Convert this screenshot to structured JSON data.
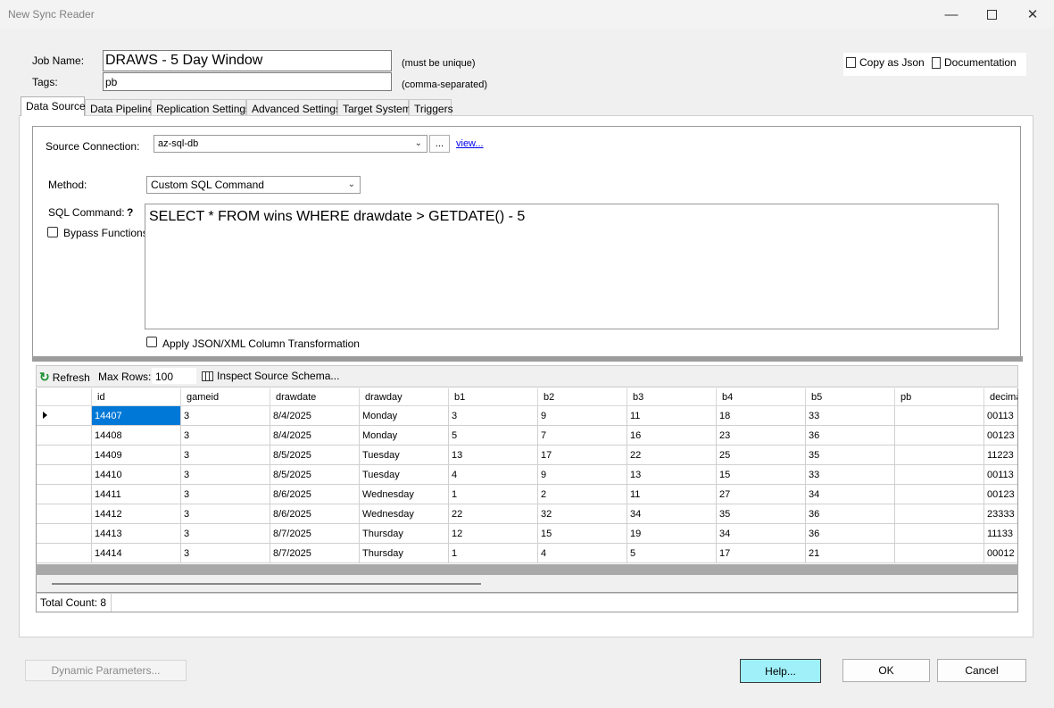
{
  "window": {
    "title": "New Sync Reader"
  },
  "header": {
    "job_name_label": "Job Name:",
    "job_name_value": "DRAWS - 5 Day Window",
    "job_name_hint": "(must be unique)",
    "tags_label": "Tags:",
    "tags_value": "pb",
    "tags_hint": "(comma-separated)",
    "copy_json_label": "Copy as Json",
    "documentation_label": "Documentation"
  },
  "tabs": [
    "Data Source",
    "Data Pipeline",
    "Replication Settings",
    "Advanced Settings",
    "Target System",
    "Triggers"
  ],
  "source": {
    "connection_label": "Source Connection:",
    "connection_value": "az-sql-db",
    "browse_label": "...",
    "view_link": "view...",
    "method_label": "Method:",
    "method_value": "Custom SQL Command",
    "sql_label": "SQL Command:",
    "help_mark": "?",
    "bypass_label": "Bypass Functions",
    "sql_value": "SELECT * FROM wins WHERE drawdate > GETDATE() - 5",
    "transform_label": "Apply JSON/XML Column Transformation"
  },
  "toolbar": {
    "refresh_label": "Refresh",
    "max_rows_label": "Max Rows:",
    "max_rows_value": "100",
    "inspect_label": "Inspect Source Schema..."
  },
  "grid": {
    "columns": [
      "id",
      "gameid",
      "drawdate",
      "drawday",
      "b1",
      "b2",
      "b3",
      "b4",
      "b5",
      "pb",
      "decima"
    ],
    "rows": [
      [
        "14407",
        "3",
        "8/4/2025",
        "Monday",
        "3",
        "9",
        "11",
        "18",
        "33",
        "",
        "00113"
      ],
      [
        "14408",
        "3",
        "8/4/2025",
        "Monday",
        "5",
        "7",
        "16",
        "23",
        "36",
        "",
        "00123"
      ],
      [
        "14409",
        "3",
        "8/5/2025",
        "Tuesday",
        "13",
        "17",
        "22",
        "25",
        "35",
        "",
        "11223"
      ],
      [
        "14410",
        "3",
        "8/5/2025",
        "Tuesday",
        "4",
        "9",
        "13",
        "15",
        "33",
        "",
        "00113"
      ],
      [
        "14411",
        "3",
        "8/6/2025",
        "Wednesday",
        "1",
        "2",
        "11",
        "27",
        "34",
        "",
        "00123"
      ],
      [
        "14412",
        "3",
        "8/6/2025",
        "Wednesday",
        "22",
        "32",
        "34",
        "35",
        "36",
        "",
        "23333"
      ],
      [
        "14413",
        "3",
        "8/7/2025",
        "Thursday",
        "12",
        "15",
        "19",
        "34",
        "36",
        "",
        "11133"
      ],
      [
        "14414",
        "3",
        "8/7/2025",
        "Thursday",
        "1",
        "4",
        "5",
        "17",
        "21",
        "",
        "00012"
      ]
    ],
    "total_count": "Total Count: 8"
  },
  "footer": {
    "dynamic_params_label": "Dynamic Parameters...",
    "help_label": "Help...",
    "ok_label": "OK",
    "cancel_label": "Cancel"
  },
  "colors": {
    "accent_help_button": "#9ff0f8",
    "selected_cell": "#0078d7",
    "link": "#0000ee"
  }
}
